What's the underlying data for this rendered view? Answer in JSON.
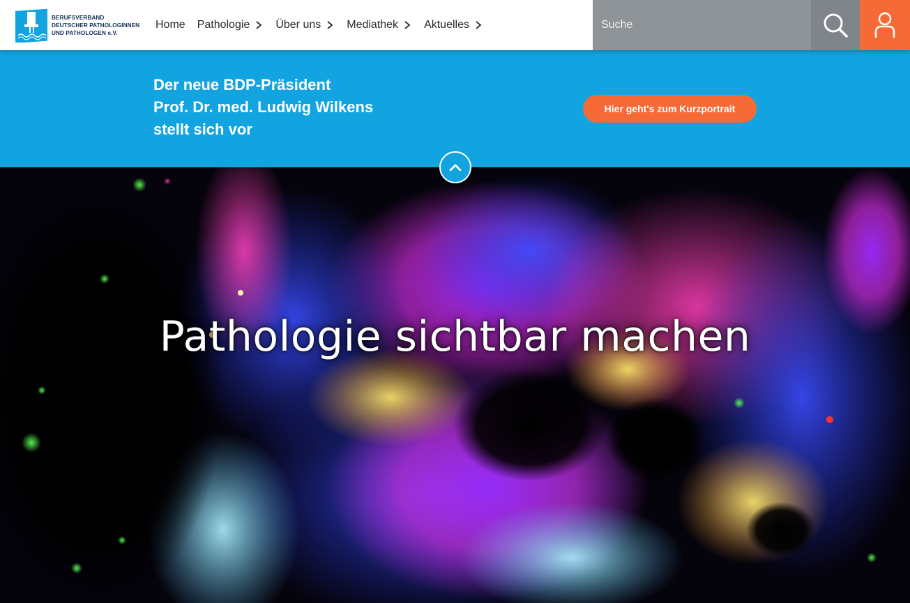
{
  "logo": {
    "line1": "BERUFSVERBAND",
    "line2": "DEUTSCHER PATHOLOGINNEN",
    "line3": "UND PATHOLOGEN e.V."
  },
  "nav": {
    "items": [
      {
        "label": "Home",
        "has_submenu": false
      },
      {
        "label": "Pathologie",
        "has_submenu": true
      },
      {
        "label": "Über uns",
        "has_submenu": true
      },
      {
        "label": "Mediathek",
        "has_submenu": true
      },
      {
        "label": "Aktuelles",
        "has_submenu": true
      }
    ]
  },
  "search": {
    "placeholder": "Suche",
    "icon": "search-icon"
  },
  "account": {
    "icon": "user-icon"
  },
  "banner": {
    "line1": "Der neue BDP-Präsident",
    "line2": "Prof. Dr. med. Ludwig Wilkens",
    "line3": "stellt sich vor",
    "cta_label": "Hier geht's zum Kurzportrait",
    "collapse_icon": "chevron-up-icon"
  },
  "hero": {
    "title": "Pathologie sichtbar machen"
  },
  "colors": {
    "brand_blue": "#12a4e0",
    "accent_orange": "#f56a37",
    "search_gray": "#8e9398",
    "logo_navy": "#14315a"
  }
}
